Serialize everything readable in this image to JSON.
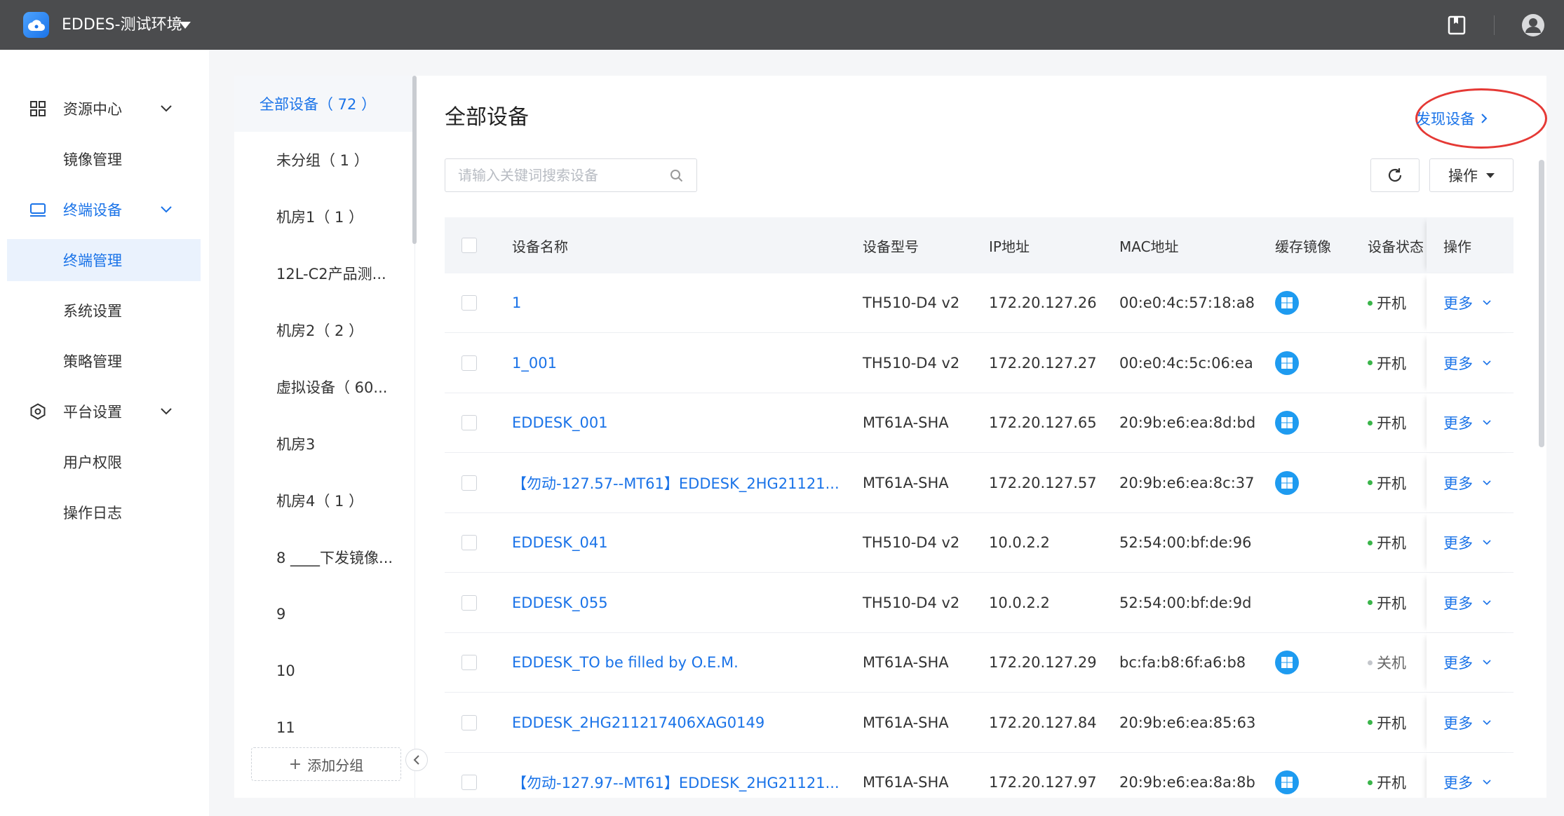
{
  "topbar": {
    "env_title": "EDDES-测试环境",
    "icons": [
      "cloud-logo-icon",
      "book-icon",
      "user-avatar-icon"
    ]
  },
  "nav": {
    "groups": [
      {
        "label": "资源中心",
        "icon": "grid-icon",
        "expanded": true,
        "items": [
          {
            "label": "镜像管理"
          }
        ]
      },
      {
        "label": "终端设备",
        "icon": "monitor-icon",
        "expanded": true,
        "active": true,
        "items": [
          {
            "label": "终端管理",
            "selected": true
          },
          {
            "label": "系统设置"
          },
          {
            "label": "策略管理"
          }
        ]
      },
      {
        "label": "平台设置",
        "icon": "settings-hex-icon",
        "expanded": true,
        "items": [
          {
            "label": "用户权限"
          },
          {
            "label": "操作日志"
          }
        ]
      }
    ]
  },
  "groups_panel": {
    "items": [
      "全部设备（ 72 ）",
      "未分组（ 1 ）",
      "机房1（ 1 ）",
      "12L-C2产品测...",
      "机房2（ 2 ）",
      "虚拟设备（ 60...",
      "机房3",
      "机房4（ 1 ）",
      "8 ____下发镜像...",
      "9",
      "10",
      "11"
    ],
    "add_group_label": "添加分组"
  },
  "content": {
    "title": "全部设备",
    "discover_label": "发现设备",
    "search_placeholder": "请输入关键词搜索设备",
    "ops_label": "操作"
  },
  "table": {
    "headers": {
      "name": "设备名称",
      "model": "设备型号",
      "ip": "IP地址",
      "mac": "MAC地址",
      "image": "缓存镜像",
      "status": "设备状态",
      "ops": "操作"
    },
    "more_label": "更多",
    "rows": [
      {
        "name": "1",
        "model": "TH510-D4 v2",
        "ip": "172.20.127.26",
        "mac": "00:e0:4c:57:18:a8",
        "windows": true,
        "status": "开机",
        "on": true
      },
      {
        "name": "1_001",
        "model": "TH510-D4 v2",
        "ip": "172.20.127.27",
        "mac": "00:e0:4c:5c:06:ea",
        "windows": true,
        "status": "开机",
        "on": true
      },
      {
        "name": "EDDESK_001",
        "model": "MT61A-SHA",
        "ip": "172.20.127.65",
        "mac": "20:9b:e6:ea:8d:bd",
        "windows": true,
        "status": "开机",
        "on": true
      },
      {
        "name": "【勿动-127.57--MT61】EDDESK_2HG21121...",
        "model": "MT61A-SHA",
        "ip": "172.20.127.57",
        "mac": "20:9b:e6:ea:8c:37",
        "windows": true,
        "status": "开机",
        "on": true
      },
      {
        "name": "EDDESK_041",
        "model": "TH510-D4 v2",
        "ip": "10.0.2.2",
        "mac": "52:54:00:bf:de:96",
        "windows": false,
        "status": "开机",
        "on": true
      },
      {
        "name": "EDDESK_055",
        "model": "TH510-D4 v2",
        "ip": "10.0.2.2",
        "mac": "52:54:00:bf:de:9d",
        "windows": false,
        "status": "开机",
        "on": true
      },
      {
        "name": "EDDESK_TO be filled by O.E.M.",
        "model": "MT61A-SHA",
        "ip": "172.20.127.29",
        "mac": "bc:fa:b8:6f:a6:b8",
        "windows": true,
        "status": "关机",
        "on": false
      },
      {
        "name": "EDDESK_2HG211217406XAG0149",
        "model": "MT61A-SHA",
        "ip": "172.20.127.84",
        "mac": "20:9b:e6:ea:85:63",
        "windows": false,
        "status": "开机",
        "on": true
      },
      {
        "name": "【勿动-127.97--MT61】EDDESK_2HG21121...",
        "model": "MT61A-SHA",
        "ip": "172.20.127.97",
        "mac": "20:9b:e6:ea:8a:8b",
        "windows": true,
        "status": "开机",
        "on": true
      }
    ]
  },
  "colors": {
    "topbar": "#4b4c4e",
    "accent": "#1a73e8",
    "status_on": "#3ab54a",
    "status_off": "#c3c6cb",
    "highlight_circle": "#e53935"
  }
}
